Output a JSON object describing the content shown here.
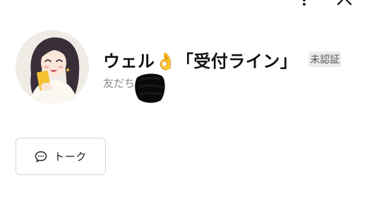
{
  "header": {
    "more_icon": "more-vertical-icon",
    "close_icon": "close-icon"
  },
  "profile": {
    "name_prefix": "ウェル",
    "name_emoji": "👌",
    "name_suffix": "「受付ライン」",
    "verification_badge": "未認証",
    "friends_label": "友だち"
  },
  "actions": {
    "talk_label": "トーク",
    "talk_icon": "chat-bubble-icon"
  },
  "colors": {
    "badge_background": "#ececec",
    "secondary_text": "#8a8a8a",
    "button_border": "#d4d4d4"
  }
}
